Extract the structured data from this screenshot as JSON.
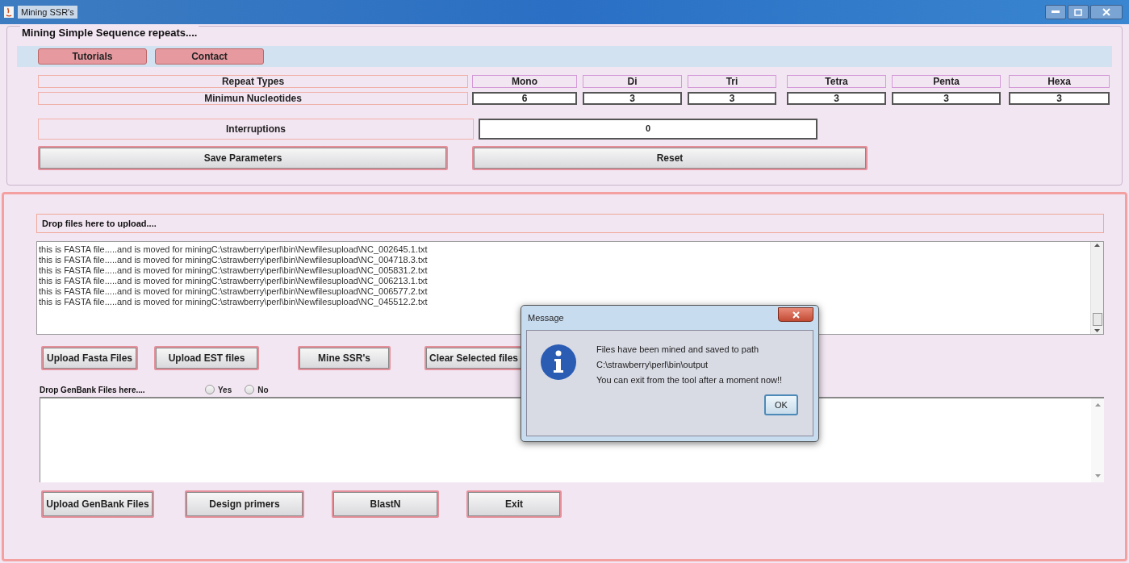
{
  "window": {
    "title": "Mining SSR's"
  },
  "top_panel": {
    "title": "Mining Simple Sequence repeats....",
    "menu_buttons": [
      "Tutorials",
      "Contact"
    ],
    "repeat_types": {
      "label": "Repeat Types",
      "values": [
        "Mono",
        "Di",
        "Tri",
        "Tetra",
        "Penta",
        "Hexa"
      ]
    },
    "minimum_nucleotides": {
      "label": "Minimun Nucleotides",
      "values": [
        "6",
        "3",
        "3",
        "3",
        "3",
        "3"
      ]
    },
    "interruptions": {
      "label": "Interruptions",
      "value": "0"
    },
    "buttons": [
      "Save Parameters",
      "Reset"
    ]
  },
  "upload_panel": {
    "drop_label": "Drop files here to upload....",
    "log_lines": [
      "this is FASTA file.....and is moved for miningC:\\strawberry\\perl\\bin\\Newfilesupload\\NC_002645.1.txt",
      "this is FASTA file.....and is moved for miningC:\\strawberry\\perl\\bin\\Newfilesupload\\NC_004718.3.txt",
      "this is FASTA file.....and is moved for miningC:\\strawberry\\perl\\bin\\Newfilesupload\\NC_005831.2.txt",
      "this is FASTA file.....and is moved for miningC:\\strawberry\\perl\\bin\\Newfilesupload\\NC_006213.1.txt",
      "this is FASTA file.....and is moved for miningC:\\strawberry\\perl\\bin\\Newfilesupload\\NC_006577.2.txt",
      "this is FASTA file.....and is moved for miningC:\\strawberry\\perl\\bin\\Newfilesupload\\NC_045512.2.txt"
    ],
    "buttons": [
      "Upload Fasta Files",
      "Upload EST files",
      "Mine SSR's",
      "Clear Selected files"
    ],
    "genbank_label": "Drop GenBank Files here....",
    "radios": [
      {
        "label": "Yes",
        "selected": false
      },
      {
        "label": "No",
        "selected": false
      }
    ],
    "bottom_buttons": [
      "Upload GenBank Files",
      "Design primers",
      "BlastN",
      "Exit"
    ]
  },
  "dialog": {
    "title": "Message",
    "lines": [
      "Files have been mined and saved to path",
      "C:\\strawberry\\perl\\bin\\output",
      "You can exit from the tool after a moment now!!"
    ],
    "button": "OK"
  }
}
